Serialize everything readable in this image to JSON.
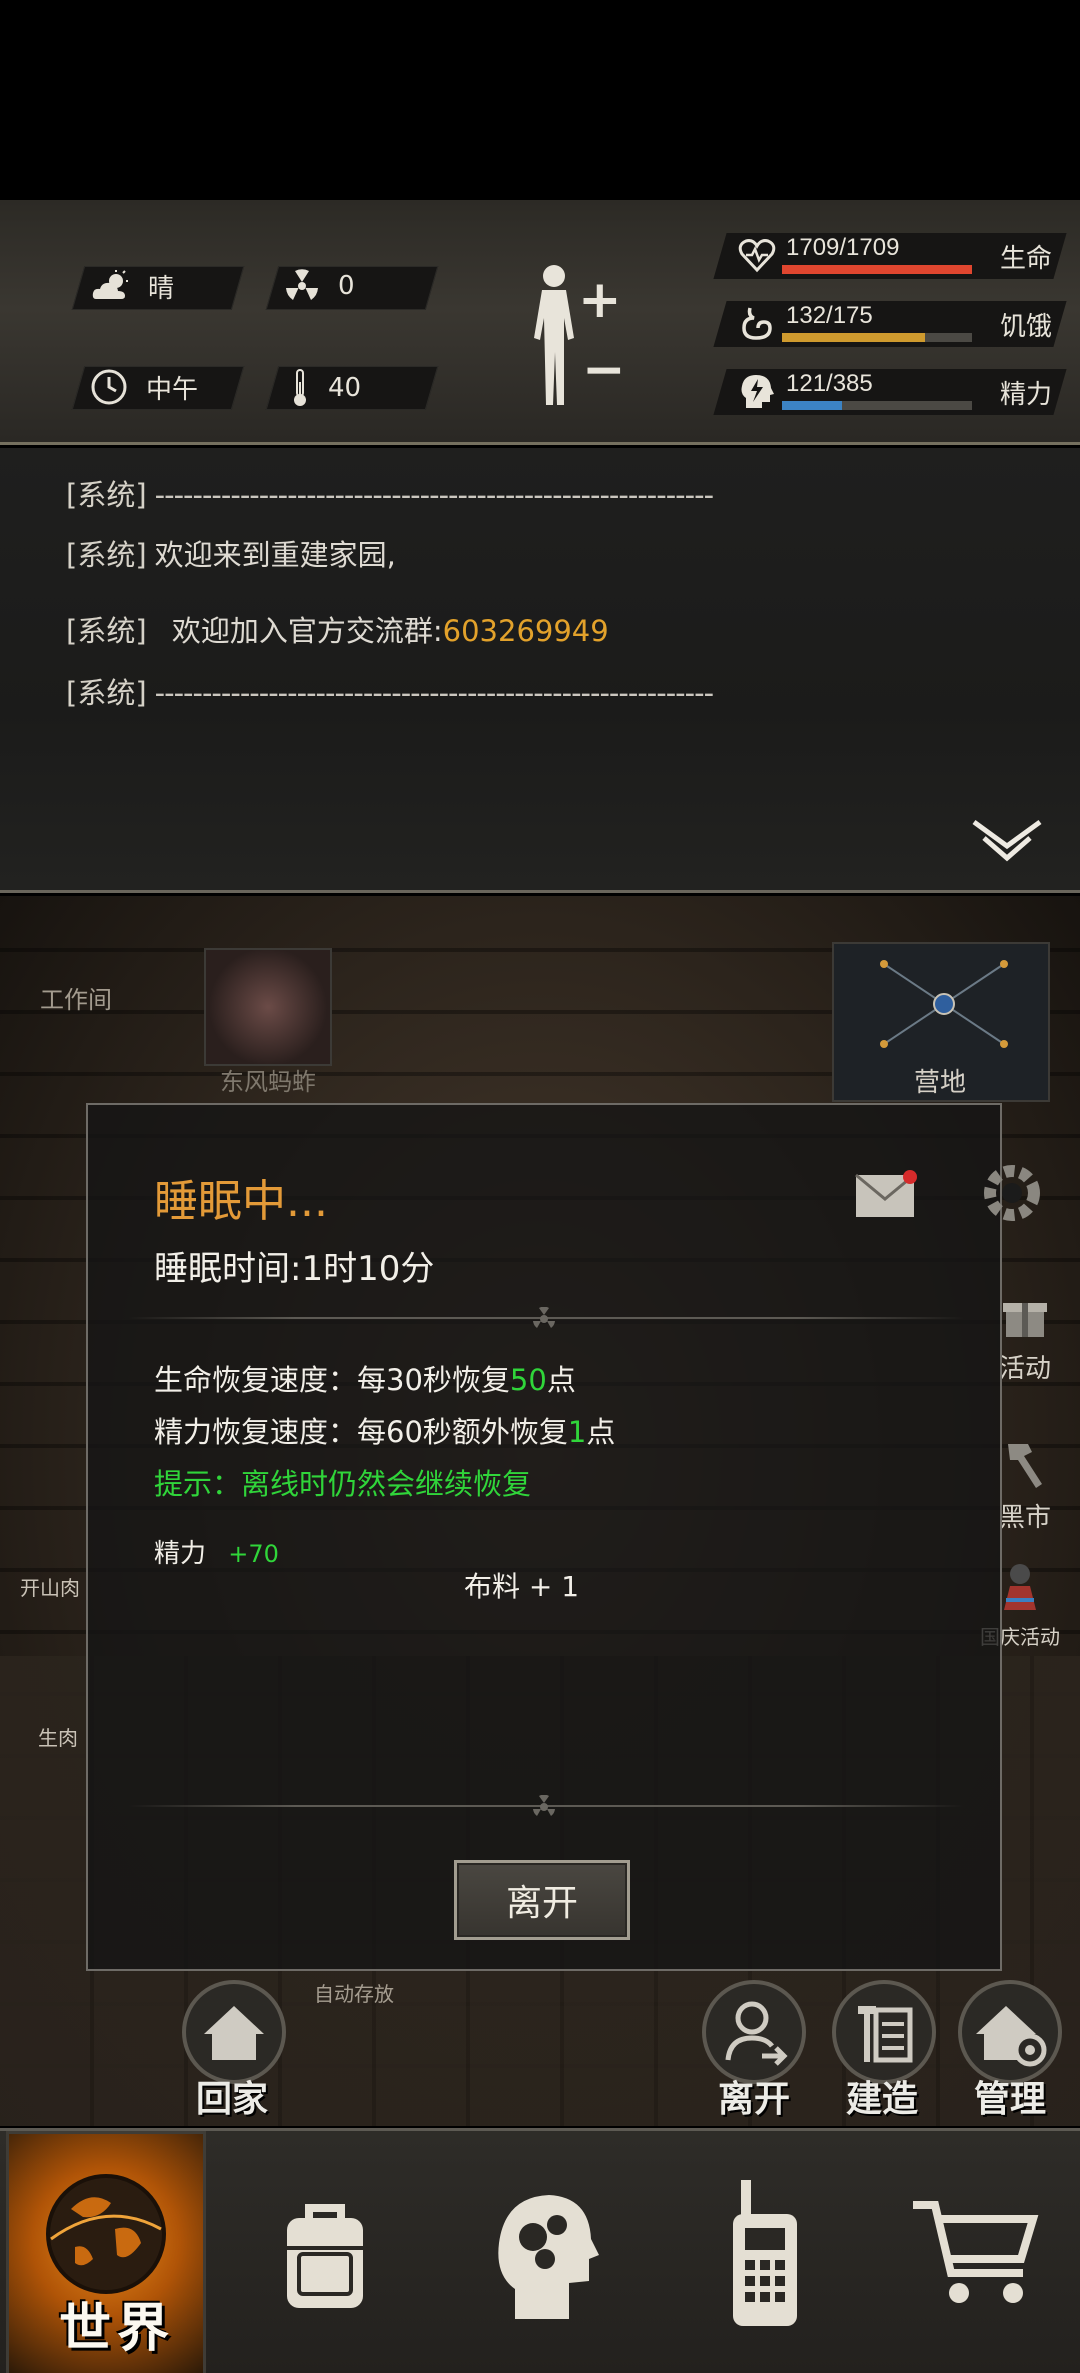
{
  "status": {
    "weather": {
      "icon": "cloud-sun-icon",
      "label": "晴"
    },
    "radiation": {
      "icon": "radiation-icon",
      "value": "0"
    },
    "time_of_day": {
      "icon": "clock-icon",
      "label": "中午"
    },
    "temperature": {
      "icon": "thermometer-icon",
      "value": "40"
    },
    "body_buttons": {
      "plus": "+",
      "minus": "−"
    },
    "health": {
      "icon": "heart-icon",
      "value": "1709/1709",
      "label": "生命",
      "ratio": 1.0,
      "color": "#e0462f"
    },
    "hunger": {
      "icon": "stomach-icon",
      "value": "132/175",
      "label": "饥饿",
      "ratio": 0.754,
      "color": "#cf9a2e"
    },
    "energy": {
      "icon": "lightning-head-icon",
      "value": "121/385",
      "label": "精力",
      "ratio": 0.314,
      "color": "#3c83c4"
    }
  },
  "log": {
    "system_tag": "[系统]",
    "lines": [
      {
        "text": "-----------------------------------------------------------"
      },
      {
        "text": "欢迎来到重建家园,"
      },
      {
        "text": "欢迎加入官方交流群:",
        "highlight": "603269949"
      },
      {
        "text": "-----------------------------------------------------------"
      }
    ],
    "collapse_icon": "double-chevron-down-icon"
  },
  "scene": {
    "workshop_label": "工作间",
    "npc_label": "东风蚂蚱",
    "camp_label": "营地",
    "labels_left": [
      "开山肉",
      "生肉"
    ],
    "auto_storage_label": "自动存放",
    "side_buttons": [
      {
        "icon": "gift-icon",
        "label": "活动"
      },
      {
        "icon": "hammer-icon",
        "label": "黑市"
      },
      {
        "icon": "event-icon",
        "label": "国庆活动"
      }
    ],
    "round_buttons": [
      {
        "icon": "home-icon",
        "label": "回家"
      },
      {
        "icon": "person-exit-icon",
        "label": "离开"
      },
      {
        "icon": "build-icon",
        "label": "建造"
      },
      {
        "icon": "house-gear-icon",
        "label": "管理"
      }
    ]
  },
  "dialog": {
    "title": "睡眠中...",
    "sleep_time": "睡眠时间:1时10分",
    "health_regen_prefix": "生命恢复速度：每30秒恢复",
    "health_regen_value": "50",
    "health_regen_suffix": "点",
    "energy_regen_prefix": "精力恢复速度：每60秒额外恢复",
    "energy_regen_value": "1",
    "energy_regen_suffix": "点",
    "tip": "提示：离线时仍然会继续恢复",
    "energy_gain_label": "精力",
    "energy_gain_value": "+70",
    "item_gain": "布料 + 1",
    "leave_button": "离开",
    "mail_icon": "mail-icon",
    "settings_icon": "gear-icon"
  },
  "nav": {
    "world_label": "世界",
    "items": [
      {
        "icon": "globe-icon",
        "label": "世界"
      },
      {
        "icon": "backpack-icon"
      },
      {
        "icon": "brain-head-icon"
      },
      {
        "icon": "walkie-talkie-icon"
      },
      {
        "icon": "shopping-cart-icon"
      }
    ]
  }
}
